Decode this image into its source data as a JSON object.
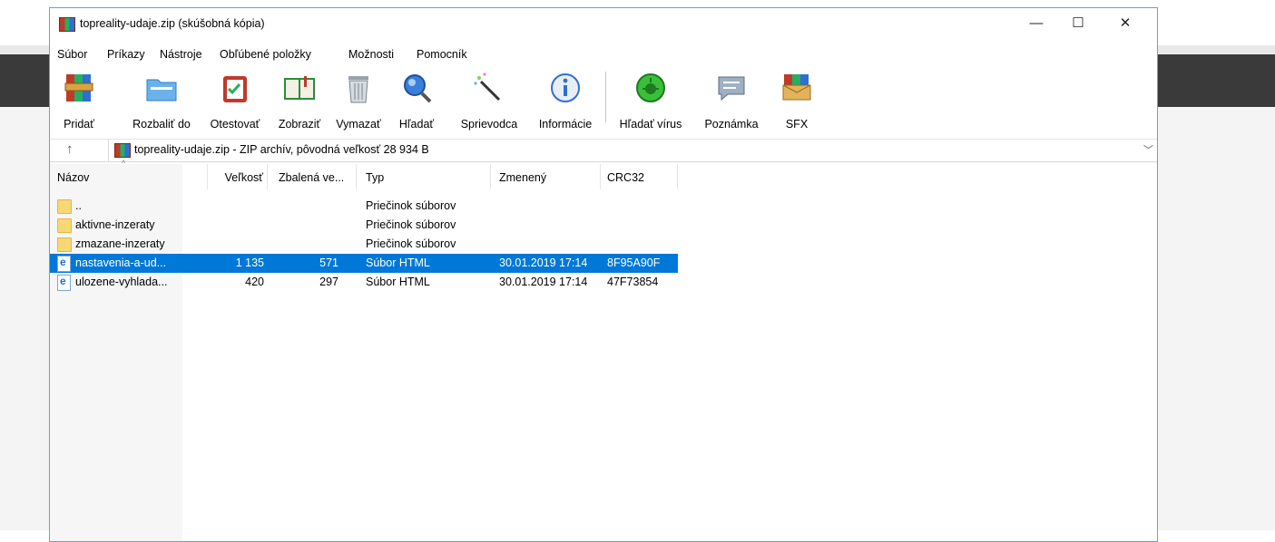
{
  "window": {
    "title": "topreality-udaje.zip (skúšobná kópia)"
  },
  "window_controls": {
    "minimize": "—",
    "maximize": "☐",
    "close": "✕"
  },
  "menu": [
    "Súbor",
    "Príkazy",
    "Nástroje",
    "Obľúbené položky",
    "Možnosti",
    "Pomocník"
  ],
  "toolbar": [
    {
      "label": "Pridať",
      "icon": "add-archive-icon"
    },
    {
      "label": "Rozbaliť do",
      "icon": "extract-to-icon"
    },
    {
      "label": "Otestovať",
      "icon": "test-icon"
    },
    {
      "label": "Zobraziť",
      "icon": "view-book-icon"
    },
    {
      "label": "Vymazať",
      "icon": "trash-icon"
    },
    {
      "label": "Hľadať",
      "icon": "search-icon"
    },
    {
      "label": "Sprievodca",
      "icon": "wizard-wand-icon"
    },
    {
      "label": "Informácie",
      "icon": "info-icon"
    },
    {
      "label": "Hľadať vírus",
      "icon": "virus-scan-icon"
    },
    {
      "label": "Poznámka",
      "icon": "comment-icon"
    },
    {
      "label": "SFX",
      "icon": "sfx-icon"
    }
  ],
  "address": {
    "text": "topreality-udaje.zip - ZIP archív, pôvodná veľkosť 28 934 B"
  },
  "columns": [
    "Názov",
    "Veľkosť",
    "Zbalená ve...",
    "Typ",
    "Zmenený",
    "CRC32"
  ],
  "files": [
    {
      "name": "..",
      "size": "",
      "packed": "",
      "type": "Priečinok súborov",
      "modified": "",
      "crc": "",
      "kind": "folder"
    },
    {
      "name": "aktivne-inzeraty",
      "size": "",
      "packed": "",
      "type": "Priečinok súborov",
      "modified": "",
      "crc": "",
      "kind": "folder"
    },
    {
      "name": "zmazane-inzeraty",
      "size": "",
      "packed": "",
      "type": "Priečinok súborov",
      "modified": "",
      "crc": "",
      "kind": "folder"
    },
    {
      "name": "nastavenia-a-ud...",
      "size": "1 135",
      "packed": "571",
      "type": "Súbor HTML",
      "modified": "30.01.2019 17:14",
      "crc": "8F95A90F",
      "kind": "html",
      "selected": true
    },
    {
      "name": "ulozene-vyhlada...",
      "size": "420",
      "packed": "297",
      "type": "Súbor HTML",
      "modified": "30.01.2019 17:14",
      "crc": "47F73854",
      "kind": "html"
    }
  ]
}
